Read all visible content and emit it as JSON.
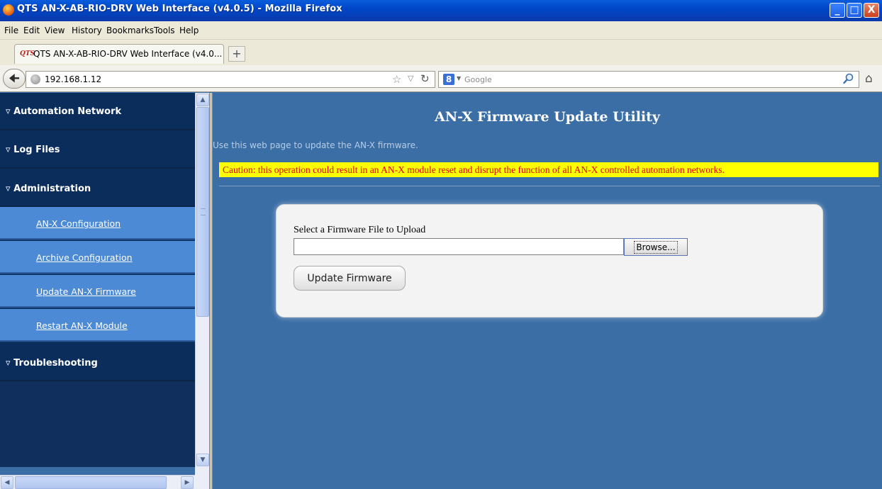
{
  "window": {
    "title": "QTS AN-X-AB-RIO-DRV Web Interface (v4.0.5) - Mozilla Firefox",
    "minimize": "_",
    "maximize": "□",
    "close": "X"
  },
  "menu": {
    "items": [
      "File",
      "Edit",
      "View",
      "History",
      "Bookmarks",
      "Tools",
      "Help"
    ]
  },
  "tab": {
    "favicon": "QTS",
    "label": "QTS AN-X-AB-RIO-DRV Web Interface (v4.0...",
    "new_tab": "+"
  },
  "nav": {
    "url": "192.168.1.12",
    "search_placeholder": "Google",
    "search_engine": "8"
  },
  "sidebar": {
    "sections": [
      {
        "label": "Automation Network"
      },
      {
        "label": "Log Files"
      },
      {
        "label": "Administration"
      },
      {
        "label": "Troubleshooting"
      }
    ],
    "admin_items": [
      {
        "label": "AN-X Configuration"
      },
      {
        "label": "Archive Configuration"
      },
      {
        "label": "Update AN-X Firmware"
      },
      {
        "label": "Restart AN-X Module"
      }
    ]
  },
  "main": {
    "title": "AN-X Firmware Update Utility",
    "intro": "Use this web page to update the AN-X firmware.",
    "caution": "Caution: this operation could result in an AN-X module reset and disrupt the function of all AN-X controlled automation networks.",
    "file_label": "Select a Firmware File to Upload",
    "file_value": "",
    "browse_label": "Browse...",
    "update_label": "Update Firmware"
  },
  "colors": {
    "sidebar_section": "#0a2d5c",
    "sidebar_item": "#4c8ad6",
    "main_bg": "#3a6ea5",
    "caution_bg": "#ffff00",
    "caution_text": "#e00000"
  }
}
